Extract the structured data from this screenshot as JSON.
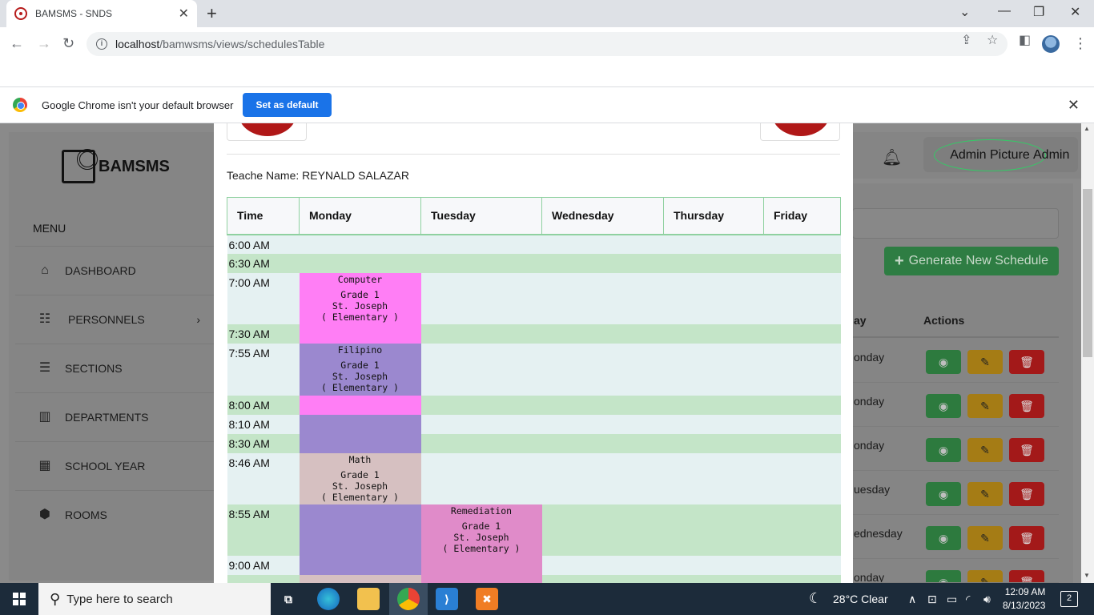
{
  "browser": {
    "tab_title": "BAMSMS - SNDS",
    "url_host": "localhost",
    "url_path": "/bamwsms/views/schedulesTable",
    "infobar_text": "Google Chrome isn't your default browser",
    "infobar_button": "Set as default"
  },
  "sidebar": {
    "brand": "BAMSMS",
    "menu_label": "MENU",
    "items": [
      {
        "label": "DASHBOARD",
        "icon": "home-icon"
      },
      {
        "label": "PERSONNELS",
        "icon": "people-icon"
      },
      {
        "label": "SECTIONS",
        "icon": "list-icon"
      },
      {
        "label": "DEPARTMENTS",
        "icon": "chart-icon"
      },
      {
        "label": "SCHOOL YEAR",
        "icon": "calendar-icon"
      },
      {
        "label": "ROOMS",
        "icon": "cube-icon"
      }
    ]
  },
  "header": {
    "admin_picture_alt": "Admin Picture",
    "admin_name": "Admin"
  },
  "main": {
    "generate_button": "Generate New Schedule",
    "col_day": "ay",
    "col_actions": "Actions",
    "rows": [
      {
        "day": "onday"
      },
      {
        "day": "onday"
      },
      {
        "day": "onday"
      },
      {
        "day": "uesday"
      },
      {
        "day": "ednesday"
      },
      {
        "day": "onday"
      }
    ]
  },
  "modal": {
    "teacher_line": "Teache Name: REYNALD SALAZAR",
    "columns": [
      "Time",
      "Monday",
      "Tuesday",
      "Wednesday",
      "Thursday",
      "Friday"
    ],
    "times": [
      "6:00 AM",
      "6:30 AM",
      "7:00 AM",
      "7:30 AM",
      "7:55 AM",
      "8:00 AM",
      "8:10 AM",
      "8:30 AM",
      "8:46 AM",
      "8:55 AM",
      "9:00 AM"
    ],
    "slots": {
      "computer": {
        "subject": "Computer",
        "grade": "Grade 1",
        "section": "St. Joseph",
        "level": "( Elementary )"
      },
      "filipino": {
        "subject": "Filipino",
        "grade": "Grade 1",
        "section": "St. Joseph",
        "level": "( Elementary )"
      },
      "math": {
        "subject": "Math",
        "grade": "Grade 1",
        "section": "St. Joseph",
        "level": "( Elementary )"
      },
      "remediation": {
        "subject": "Remediation",
        "grade": "Grade 1",
        "section": "St. Joseph",
        "level": "( Elementary )"
      }
    },
    "colors": {
      "computer": "#ff7ef5",
      "filipino": "#9b88cf",
      "math": "#d6c0c1",
      "remediation": "#e08bc9",
      "row_light": "#e5f1f2",
      "row_green": "#c4e5c8"
    }
  },
  "taskbar": {
    "search_placeholder": "Type here to search",
    "weather": "28°C  Clear",
    "time": "12:09 AM",
    "date": "8/13/2023",
    "notifications": "2"
  }
}
